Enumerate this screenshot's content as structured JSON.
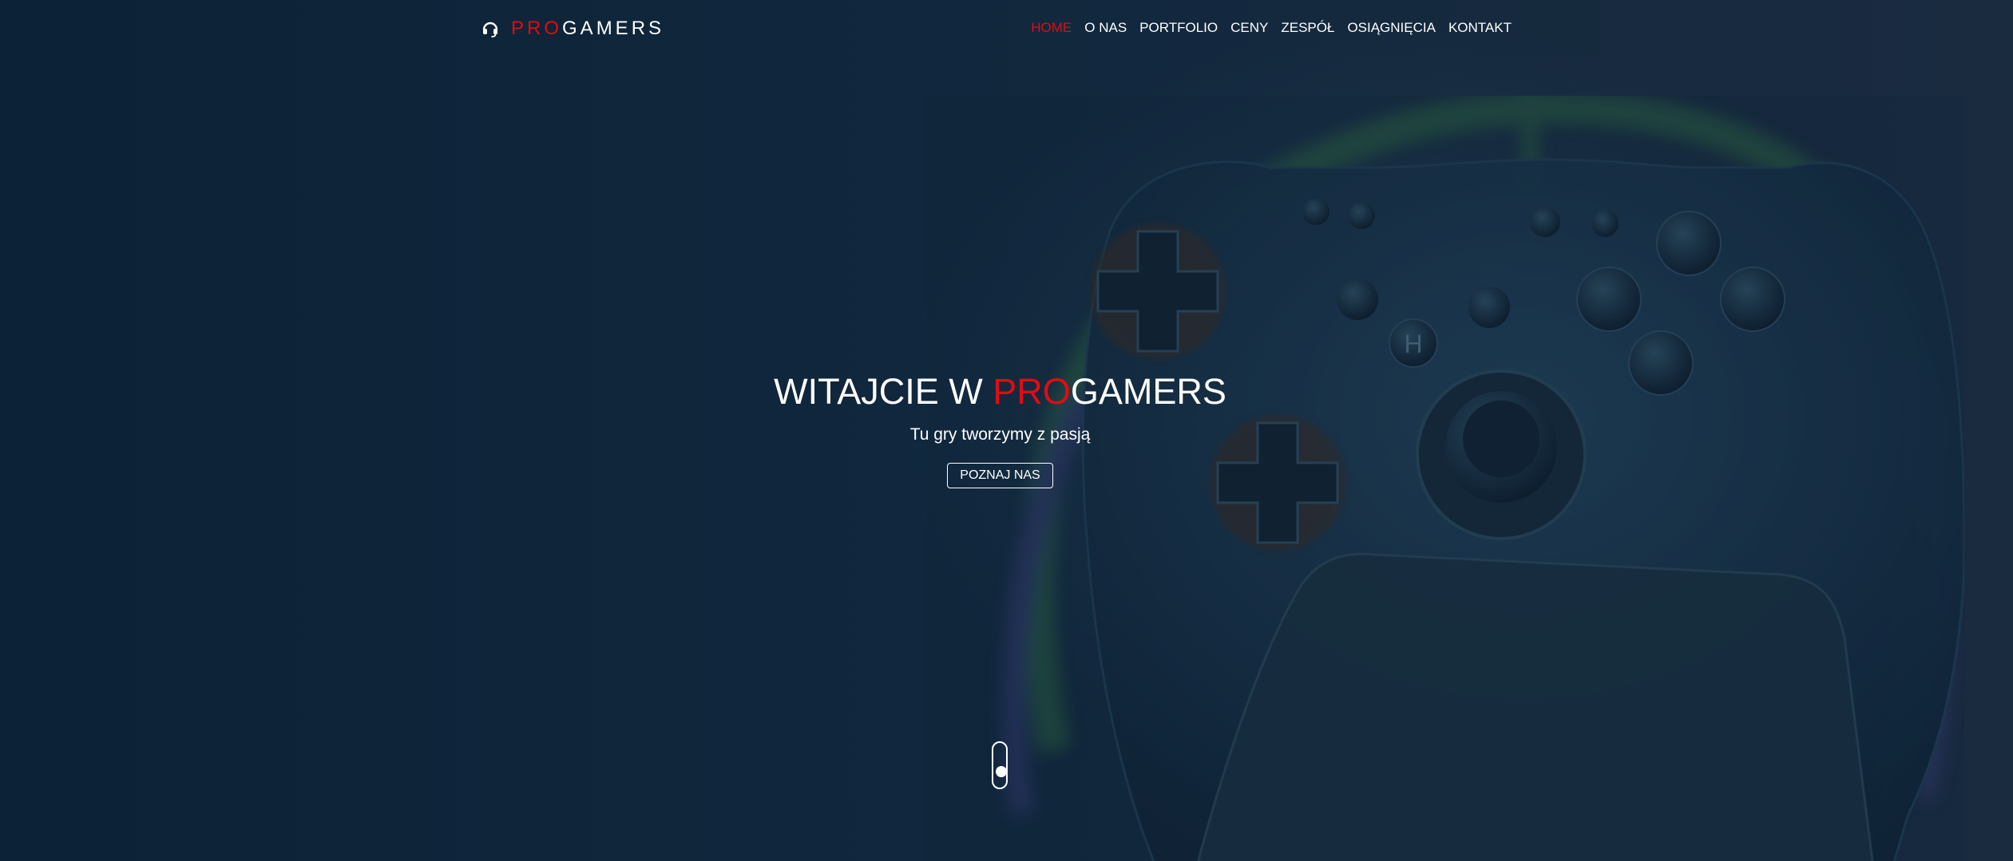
{
  "brand": {
    "accent_part": "PRO",
    "rest_part": "GAMERS",
    "icon": "headset-icon",
    "accent_color": "#e10b14"
  },
  "nav": {
    "items": [
      {
        "label": "HOME",
        "active": true
      },
      {
        "label": "O NAS"
      },
      {
        "label": "PORTFOLIO"
      },
      {
        "label": "CENY"
      },
      {
        "label": "ZESPÓŁ"
      },
      {
        "label": "OSIĄGNIĘCIA"
      },
      {
        "label": "KONTAKT"
      }
    ]
  },
  "hero": {
    "title_prefix": "WITAJCIE W ",
    "title_accent": "PRO",
    "title_suffix": "GAMERS",
    "subtitle": "Tu gry tworzymy z pasją",
    "button_label": "POZNAJ NAS",
    "background_image": "gamepad-with-smoke"
  },
  "scroll_indicator": {
    "icon": "scroll-mouse-icon"
  }
}
